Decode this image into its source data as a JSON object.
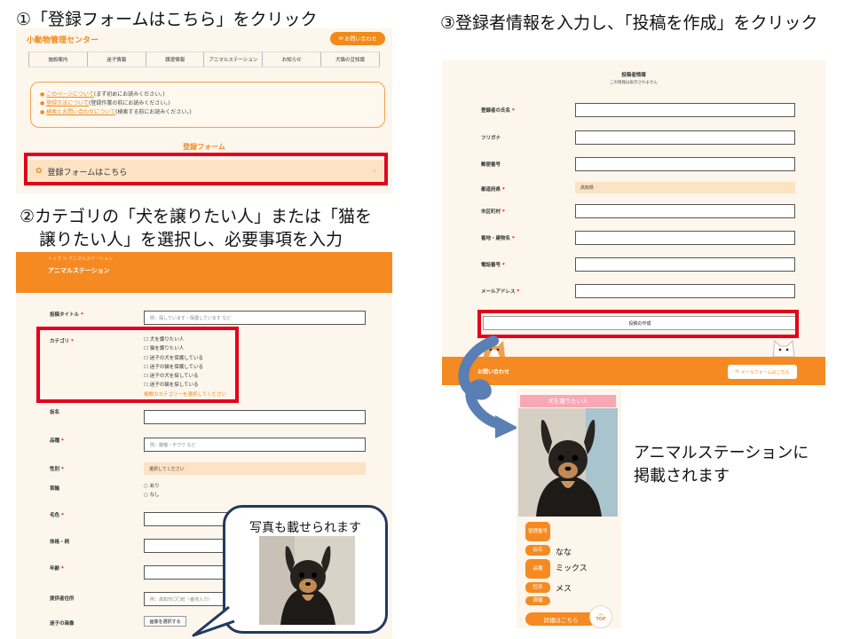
{
  "step1": {
    "heading": "①「登録フォームはこちら」をクリック",
    "brand": "小動物管理センター",
    "contact_label": "お問い合わせ",
    "nav": [
      "施設案内",
      "迷子情報",
      "譲渡情報",
      "アニマルステーション",
      "お知らせ",
      "犬猫の豆知識"
    ],
    "notices": [
      {
        "link": "このページについて",
        "text": "(まず初めにお読みください。)"
      },
      {
        "link": "登録方法について",
        "text": "(登録作業の前にお読みください。)"
      },
      {
        "link": "検索とお問い合わせについて",
        "text": "(検索する前にお読みください。)"
      }
    ],
    "form_title": "登録フォーム",
    "form_button": "登録フォームはこちら"
  },
  "step2": {
    "heading_line1": "②カテゴリの「犬を譲りたい人」または「猫を",
    "heading_line2": "譲りたい人」を選択し、必要事項を入力",
    "breadcrumb": "トップ ＞ アニマルステーション",
    "page_title": "アニマルステーション",
    "fields": {
      "post_title": {
        "label": "投稿タイトル",
        "placeholder": "例：探しています・保護しています など"
      },
      "category": {
        "label": "カテゴリ",
        "options": [
          "犬を譲りたい人",
          "猫を譲りたい人",
          "迷子の犬を保護している",
          "迷子の猫を保護している",
          "迷子の犬を探している",
          "迷子の猫を探している"
        ],
        "note": "複数のカテゴリーを選択してください"
      },
      "name": {
        "label": "仮名"
      },
      "breed": {
        "label": "品種",
        "placeholder": "例：雑種・チワワ など"
      },
      "sex": {
        "label": "性別",
        "value": "選択してください"
      },
      "collar": {
        "label": "首輪",
        "options": [
          "あり",
          "なし"
        ]
      },
      "color": {
        "label": "毛色"
      },
      "size": {
        "label": "体格・柄"
      },
      "age": {
        "label": "年齢"
      },
      "address": {
        "label": "提供者住所",
        "placeholder": "例：高知市〇〇町（番地入力）"
      },
      "photo": {
        "label": "迷子の画像",
        "button": "画像を選択する"
      }
    }
  },
  "step3": {
    "heading": "③登録者情報を入力し、「投稿を作成」をクリック",
    "section_title": "投稿者情報",
    "section_sub": "この情報は表示されません",
    "fields": [
      {
        "label": "登録者の氏名",
        "required": true
      },
      {
        "label": "フリガナ",
        "required": false
      },
      {
        "label": "郵便番号",
        "required": false
      },
      {
        "label": "都道府県",
        "required": true,
        "value": "高知県"
      },
      {
        "label": "市区町村",
        "required": true
      },
      {
        "label": "番地・建物名",
        "required": true
      },
      {
        "label": "電話番号",
        "required": true
      },
      {
        "label": "メールアドレス",
        "required": true
      }
    ],
    "submit": "投稿の作成",
    "footer_left": "お問い合わせ",
    "footer_button": "メールフォームはこちら"
  },
  "card": {
    "title": "犬を譲りたい人",
    "rows": [
      {
        "label": "管理番号",
        "value": ""
      },
      {
        "label": "仮名",
        "value": "なな"
      },
      {
        "label": "品種",
        "value": "ミックス"
      },
      {
        "label": "性別",
        "value": "メス"
      },
      {
        "label": "首輪",
        "value": ""
      }
    ],
    "more": "詳細はこちら",
    "top": "TOP"
  },
  "bubble_text": "写真も載せられます",
  "published_line1": "アニマルステーションに",
  "published_line2": "掲載されます",
  "colors": {
    "accent": "#f58a22",
    "highlight": "#e4001b",
    "card_title": "#f7a8b4",
    "arrow": "#5a7fb4"
  }
}
